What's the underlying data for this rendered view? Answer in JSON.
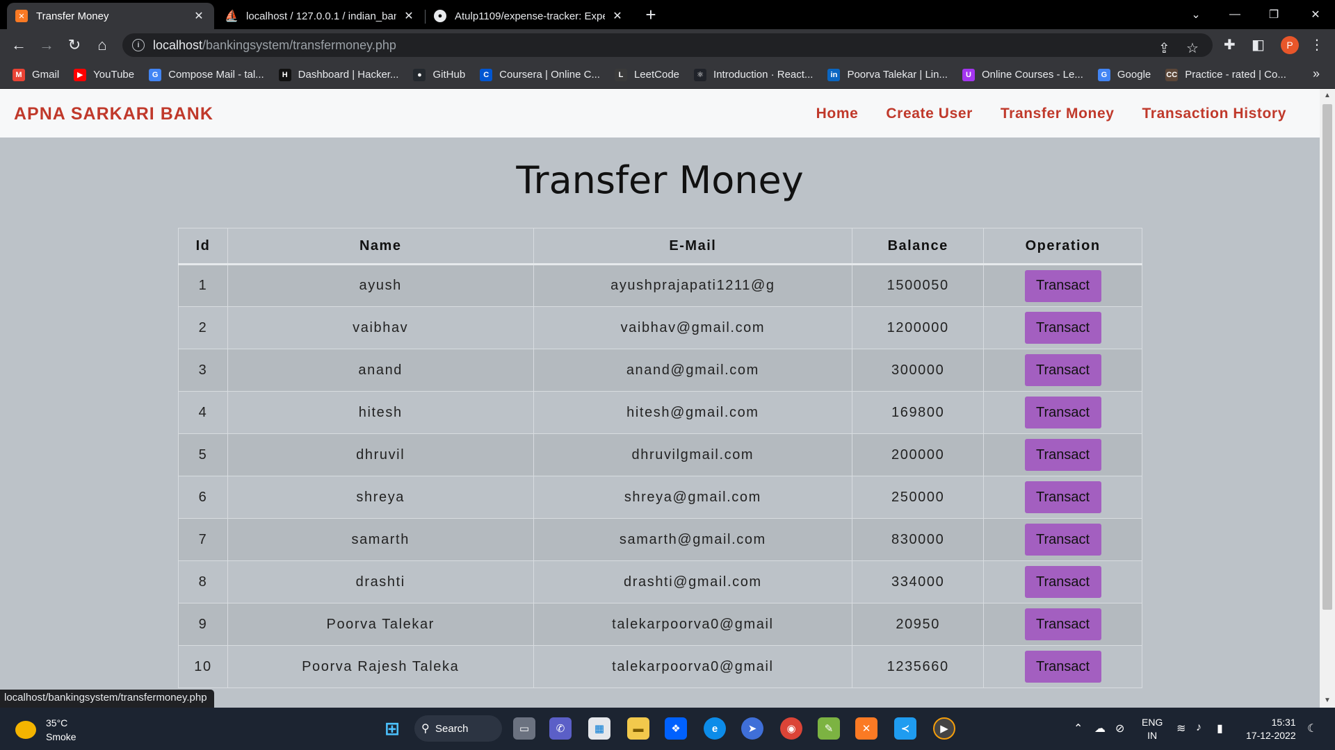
{
  "browser": {
    "tabs": [
      {
        "title": "Transfer Money",
        "favicon": "xampp-icon",
        "active": true
      },
      {
        "title": "localhost / 127.0.0.1 / indian_ban",
        "favicon": "phpmyadmin-icon",
        "active": false
      },
      {
        "title": "Atulp1109/expense-tracker: Expe",
        "favicon": "github-icon",
        "active": false
      }
    ],
    "address": {
      "host": "localhost",
      "path": "/bankingsystem/transfermoney.php"
    },
    "profile_initial": "P",
    "bookmarks": [
      {
        "label": "Gmail",
        "icon": "gmail-icon",
        "color": "#ea4335",
        "glyph": "M"
      },
      {
        "label": "YouTube",
        "icon": "youtube-icon",
        "color": "#ff0000",
        "glyph": "▶"
      },
      {
        "label": "Compose Mail - tal...",
        "icon": "google-icon",
        "color": "#4285f4",
        "glyph": "G"
      },
      {
        "label": "Dashboard | Hacker...",
        "icon": "hackerrank-icon",
        "color": "#111111",
        "glyph": "H"
      },
      {
        "label": "GitHub",
        "icon": "github-icon",
        "color": "#24292e",
        "glyph": "●"
      },
      {
        "label": "Coursera | Online C...",
        "icon": "coursera-icon",
        "color": "#0056d2",
        "glyph": "C"
      },
      {
        "label": "LeetCode",
        "icon": "leetcode-icon",
        "color": "#3a3a3a",
        "glyph": "L"
      },
      {
        "label": "Introduction · React...",
        "icon": "react-icon",
        "color": "#20232a",
        "glyph": "⚛"
      },
      {
        "label": "Poorva Talekar | Lin...",
        "icon": "linkedin-icon",
        "color": "#0a66c2",
        "glyph": "in"
      },
      {
        "label": "Online Courses - Le...",
        "icon": "udemy-icon",
        "color": "#a435f0",
        "glyph": "U"
      },
      {
        "label": "Google",
        "icon": "google-icon",
        "color": "#4285f4",
        "glyph": "G"
      },
      {
        "label": "Practice - rated | Co...",
        "icon": "codechef-icon",
        "color": "#5b4638",
        "glyph": "CC"
      }
    ]
  },
  "site": {
    "brand": "APNA SARKARI BANK",
    "nav": [
      "Home",
      "Create User",
      "Transfer Money",
      "Transaction History"
    ],
    "title": "Transfer Money"
  },
  "table": {
    "headers": [
      "Id",
      "Name",
      "E-Mail",
      "Balance",
      "Operation"
    ],
    "button_label": "Transact",
    "rows": [
      {
        "id": "1",
        "name": "ayush",
        "email": "ayushprajapati1211@g",
        "balance": "1500050"
      },
      {
        "id": "2",
        "name": "vaibhav",
        "email": "vaibhav@gmail.com",
        "balance": "1200000"
      },
      {
        "id": "3",
        "name": "anand",
        "email": "anand@gmail.com",
        "balance": "300000"
      },
      {
        "id": "4",
        "name": "hitesh",
        "email": "hitesh@gmail.com",
        "balance": "169800"
      },
      {
        "id": "5",
        "name": "dhruvil",
        "email": "dhruvilgmail.com",
        "balance": "200000"
      },
      {
        "id": "6",
        "name": "shreya",
        "email": "shreya@gmail.com",
        "balance": "250000"
      },
      {
        "id": "7",
        "name": "samarth",
        "email": "samarth@gmail.com",
        "balance": "830000"
      },
      {
        "id": "8",
        "name": "drashti",
        "email": "drashti@gmail.com",
        "balance": "334000"
      },
      {
        "id": "9",
        "name": "Poorva Talekar",
        "email": "talekarpoorva0@gmail",
        "balance": "20950"
      },
      {
        "id": "10",
        "name": "Poorva Rajesh Taleka",
        "email": "talekarpoorva0@gmail",
        "balance": "1235660"
      }
    ]
  },
  "status_url": "localhost/bankingsystem/transfermoney.php",
  "taskbar": {
    "weather": {
      "temp": "35°C",
      "condition": "Smoke"
    },
    "search_label": "Search",
    "language": {
      "line1": "ENG",
      "line2": "IN"
    },
    "clock": {
      "time": "15:31",
      "date": "17-12-2022"
    }
  },
  "colors": {
    "brand_red": "#c0392b",
    "button_purple": "#a35fc0",
    "page_bg": "#bcc2c8"
  }
}
